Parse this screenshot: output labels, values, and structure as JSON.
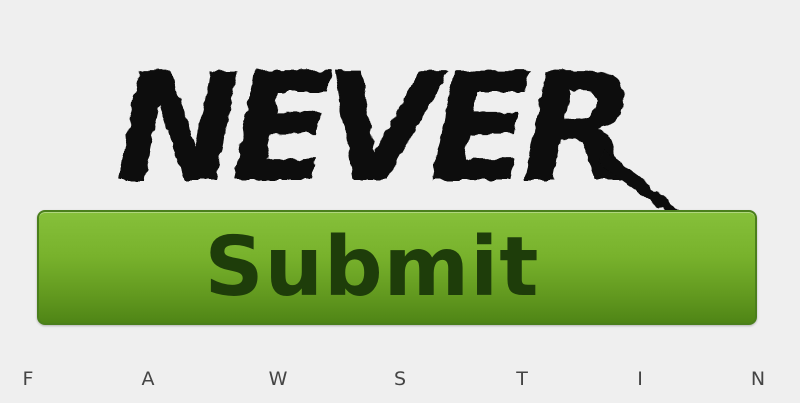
{
  "logo": {
    "text": "NEVER"
  },
  "button": {
    "label": "Submit"
  },
  "footer": {
    "letters": [
      "F",
      "A",
      "W",
      "S",
      "T",
      "I",
      "N"
    ]
  },
  "colors": {
    "background": "#efefef",
    "button_green": "#78b22c",
    "button_text": "#1e3d0a",
    "logo_black": "#0b0b0b"
  }
}
